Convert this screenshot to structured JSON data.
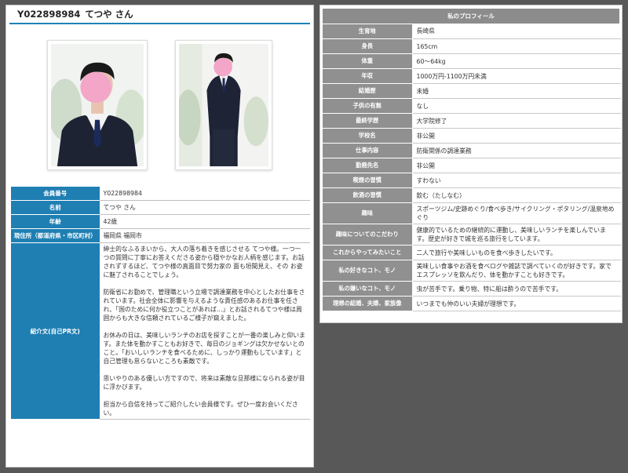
{
  "left": {
    "member_id": "Y022898984",
    "member_name": "てつや さん",
    "table": [
      {
        "label": "会員番号",
        "value": "Y022898984"
      },
      {
        "label": "名前",
        "value": "てつや さん"
      },
      {
        "label": "年齢",
        "value": "42歳"
      },
      {
        "label": "現住所（都道府県・市区町村）",
        "value": "福岡県 福岡市"
      }
    ],
    "intro_label": "紹介文(自己PR文)",
    "intro": [
      "紳士的なふるまいから、大人の落ち着きを感じさせる てつや様。一つ一つの質問に丁寧にお答えくださる姿から穏やかなお人柄を感じます。お話されずするほど、てつや様の真面目で努力家の 面も垣間見え、その お姿に魅了されることでしょう。",
      "防衛省にお勤めで、管理職という立場で調達業務を中心としたお仕事をされています。社会全体に影響を与えるような責任感のあるお仕事を任され、「国のために何か役立つことがあれば…」とお話されるてつや様は周囲からも大きな信頼されているご様子が窺えました。",
      "お休みの日は、美味しいランチのお店を探すことが一番の楽しみと仰います。また体を動かすこともお好きで、毎日のジョギングは欠かせないとのこと。「おいしいランチを食べるために、しっかり運動もしています」と自己管理も怠らないところも素敵です。",
      "思いやりのある優しい方ですので、将来は素敵な旦那様になられる姿が目に浮かびます。",
      "担当から自信を持ってご紹介したい会員様です。ぜひ一度お会いください。"
    ]
  },
  "right": {
    "header": "私のプロフィール",
    "rows": [
      {
        "label": "生育地",
        "value": "長崎県"
      },
      {
        "label": "身長",
        "value": "165cm"
      },
      {
        "label": "体重",
        "value": "60～64kg"
      },
      {
        "label": "年収",
        "value": "1000万円-1100万円未満"
      },
      {
        "label": "結婚歴",
        "value": "未婚"
      },
      {
        "label": "子供の有無",
        "value": "なし"
      },
      {
        "label": "最終学歴",
        "value": "大学院修了"
      },
      {
        "label": "学校名",
        "value": "非公開"
      },
      {
        "label": "仕事内容",
        "value": "防衛関係の調達業務"
      },
      {
        "label": "勤務先名",
        "value": "非公開"
      },
      {
        "label": "喫煙の習慣",
        "value": "すわない"
      },
      {
        "label": "飲酒の習慣",
        "value": "飲む（たしなむ）"
      },
      {
        "label": "趣味",
        "value": "スポーツジム/史跡めぐり/食べ歩き/サイクリング・ポタリング/温泉地めぐり"
      },
      {
        "label": "趣味についてのこだわり",
        "value": "健康的でいるための継続的に運動し、美味しいランチを楽しんでいます。歴史が好きで城を巡る旅行をしています。"
      },
      {
        "label": "これからやってみたいこと",
        "value": "二人で旅行や美味しいものを食べ歩きしたいです。"
      },
      {
        "label": "私の好きなコト、モノ",
        "value": "美味しい食事やお酒を食べログや雑誌で調べていくのが好きです。家でエスプレッソを飲んだり、体を動かすことも好きです。"
      },
      {
        "label": "私の嫌いなコト、モノ",
        "value": "虫が苦手です。乗り物、特に船は酔うので苦手です。"
      },
      {
        "label": "理想の結婚、夫婦、家族像",
        "value": "いつまでも仲のいい夫婦が理想です。"
      }
    ]
  },
  "colors": {
    "left_header": "#1f7fb3",
    "right_header": "#909090",
    "background": "#585858"
  }
}
